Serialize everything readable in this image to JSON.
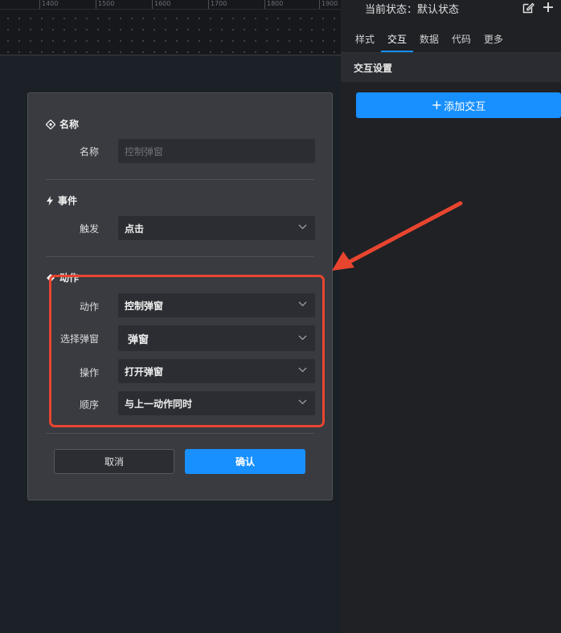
{
  "ruler": {
    "ticks": [
      "1400",
      "1500",
      "1600",
      "1700",
      "1800",
      "1900"
    ]
  },
  "right_panel": {
    "status": "当前状态：默认状态",
    "tabs": [
      {
        "label": "样式"
      },
      {
        "label": "交互"
      },
      {
        "label": "数据"
      },
      {
        "label": "代码"
      },
      {
        "label": "更多"
      }
    ],
    "active_tab": "交互",
    "section_title": "交互设置",
    "add_button_plus": "+",
    "add_button_label": "添加交互"
  },
  "modal": {
    "name_section": {
      "title": "名称",
      "label": "名称",
      "placeholder": "控制弹窗"
    },
    "event_section": {
      "title": "事件",
      "label": "触发",
      "value": "点击"
    },
    "action_section": {
      "title": "动作",
      "rows": [
        {
          "label": "动作",
          "value": "控制弹窗"
        },
        {
          "label": "选择弹窗",
          "value": "弹窗"
        },
        {
          "label": "操作",
          "value": "打开弹窗"
        },
        {
          "label": "顺序",
          "value": "与上一动作同时"
        }
      ]
    },
    "cancel_label": "取消",
    "confirm_label": "确认"
  },
  "colors": {
    "accent": "#1890ff",
    "annotation": "#e8452f",
    "modal_bg": "#393b41",
    "field_bg": "#2b2d32"
  },
  "icons": {
    "name": "diamond-icon",
    "event": "lightning-icon",
    "action": "action-icon",
    "edit": "edit-icon",
    "add": "plus-icon",
    "dropdown": "chevron-down-icon"
  }
}
